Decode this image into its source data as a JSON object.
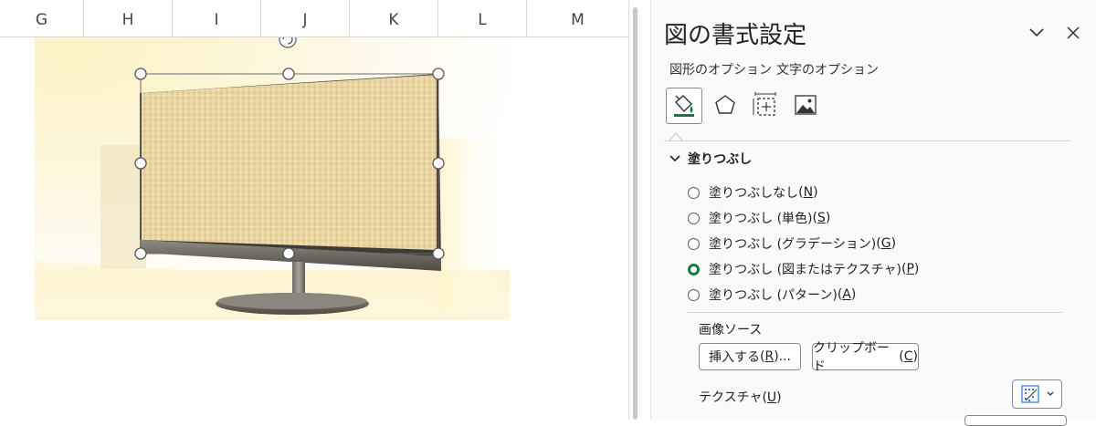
{
  "sheet": {
    "columns": [
      "G",
      "H",
      "I",
      "J",
      "K",
      "L",
      "M"
    ]
  },
  "pane": {
    "title": "図の書式設定",
    "tabs": [
      "図形のオプション",
      "文字のオプション"
    ],
    "icon_buttons": [
      "fill-line-icon",
      "effects-pentagon-icon",
      "size-properties-icon",
      "picture-icon"
    ],
    "selected_icon": "fill-line-icon",
    "section_title": "塗りつぶし",
    "fill_options": [
      {
        "label": "塗りつぶしなし",
        "key": "N",
        "checked": false
      },
      {
        "label": "塗りつぶし (単色)",
        "key": "S",
        "checked": false
      },
      {
        "label": "塗りつぶし (グラデーション)",
        "key": "G",
        "checked": false
      },
      {
        "label": "塗りつぶし (図またはテクスチャ)",
        "key": "P",
        "checked": true
      },
      {
        "label": "塗りつぶし (パターン)",
        "key": "A",
        "checked": false
      }
    ],
    "image_source_label": "画像ソース",
    "insert_button": {
      "label": "挿入する",
      "key": "R",
      "suffix": "..."
    },
    "clipboard_button": {
      "label": "クリップボード",
      "key": "C"
    },
    "texture_label": {
      "label": "テクスチャ",
      "key": "U"
    }
  },
  "colors": {
    "accent_green": "#107c41",
    "pane_bg": "#fafafa"
  }
}
